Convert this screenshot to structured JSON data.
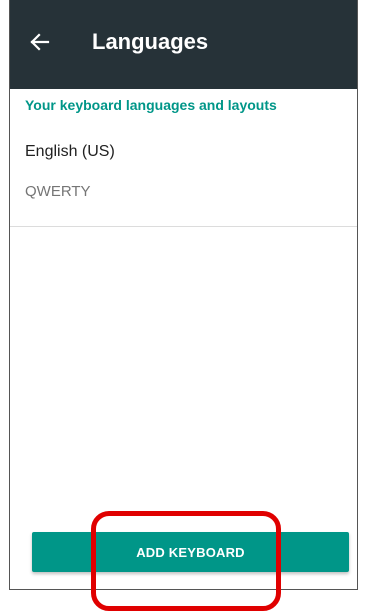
{
  "app_bar": {
    "title": "Languages",
    "back_icon": "arrow-left-icon"
  },
  "section": {
    "header": "Your keyboard languages and layouts"
  },
  "languages": [
    {
      "name": "English (US)",
      "layout": "QWERTY"
    }
  ],
  "actions": {
    "add_keyboard_label": "ADD KEYBOARD"
  },
  "colors": {
    "app_bar": "#263238",
    "accent": "#009688",
    "annotation": "#e00000"
  }
}
